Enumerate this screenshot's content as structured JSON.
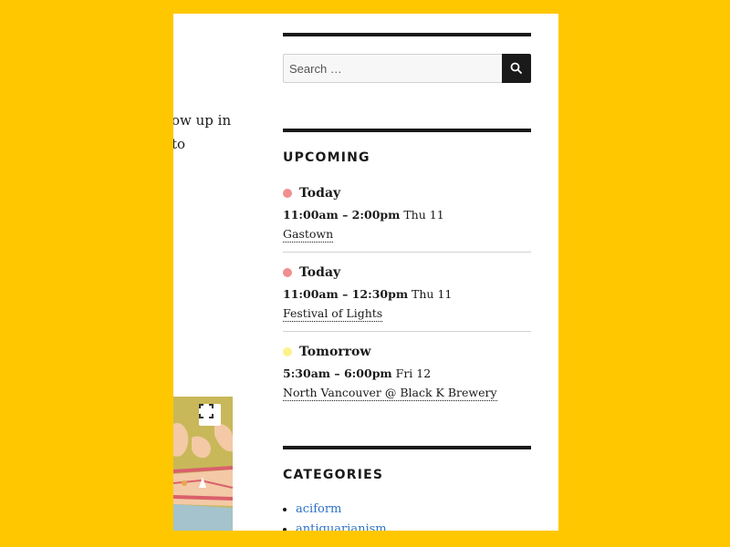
{
  "content_fragment": {
    "lines": [
      "ow up in",
      "to"
    ]
  },
  "map": {
    "fullscreen_icon": "fullscreen-icon"
  },
  "search": {
    "placeholder": "Search …",
    "button_icon": "search-icon"
  },
  "upcoming": {
    "title": "UPCOMING",
    "events": [
      {
        "day": "Today",
        "dot_color": "#f08f8f",
        "time": "11:00am – 2:00pm",
        "date": "Thu 11",
        "location": "Gastown"
      },
      {
        "day": "Today",
        "dot_color": "#f08f8f",
        "time": "11:00am – 12:30pm",
        "date": "Thu 11",
        "location": "Festival of Lights"
      },
      {
        "day": "Tomorrow",
        "dot_color": "#fdf28a",
        "time": "5:30am – 6:00pm",
        "date": "Fri 12",
        "location": "North Vancouver @ Black K Brewery"
      }
    ]
  },
  "categories": {
    "title": "CATEGORIES",
    "items": [
      "aciform",
      "antiquarianism"
    ]
  },
  "colors": {
    "background": "#ffc700",
    "link": "#2d72c4",
    "text": "#1a1a1a"
  }
}
